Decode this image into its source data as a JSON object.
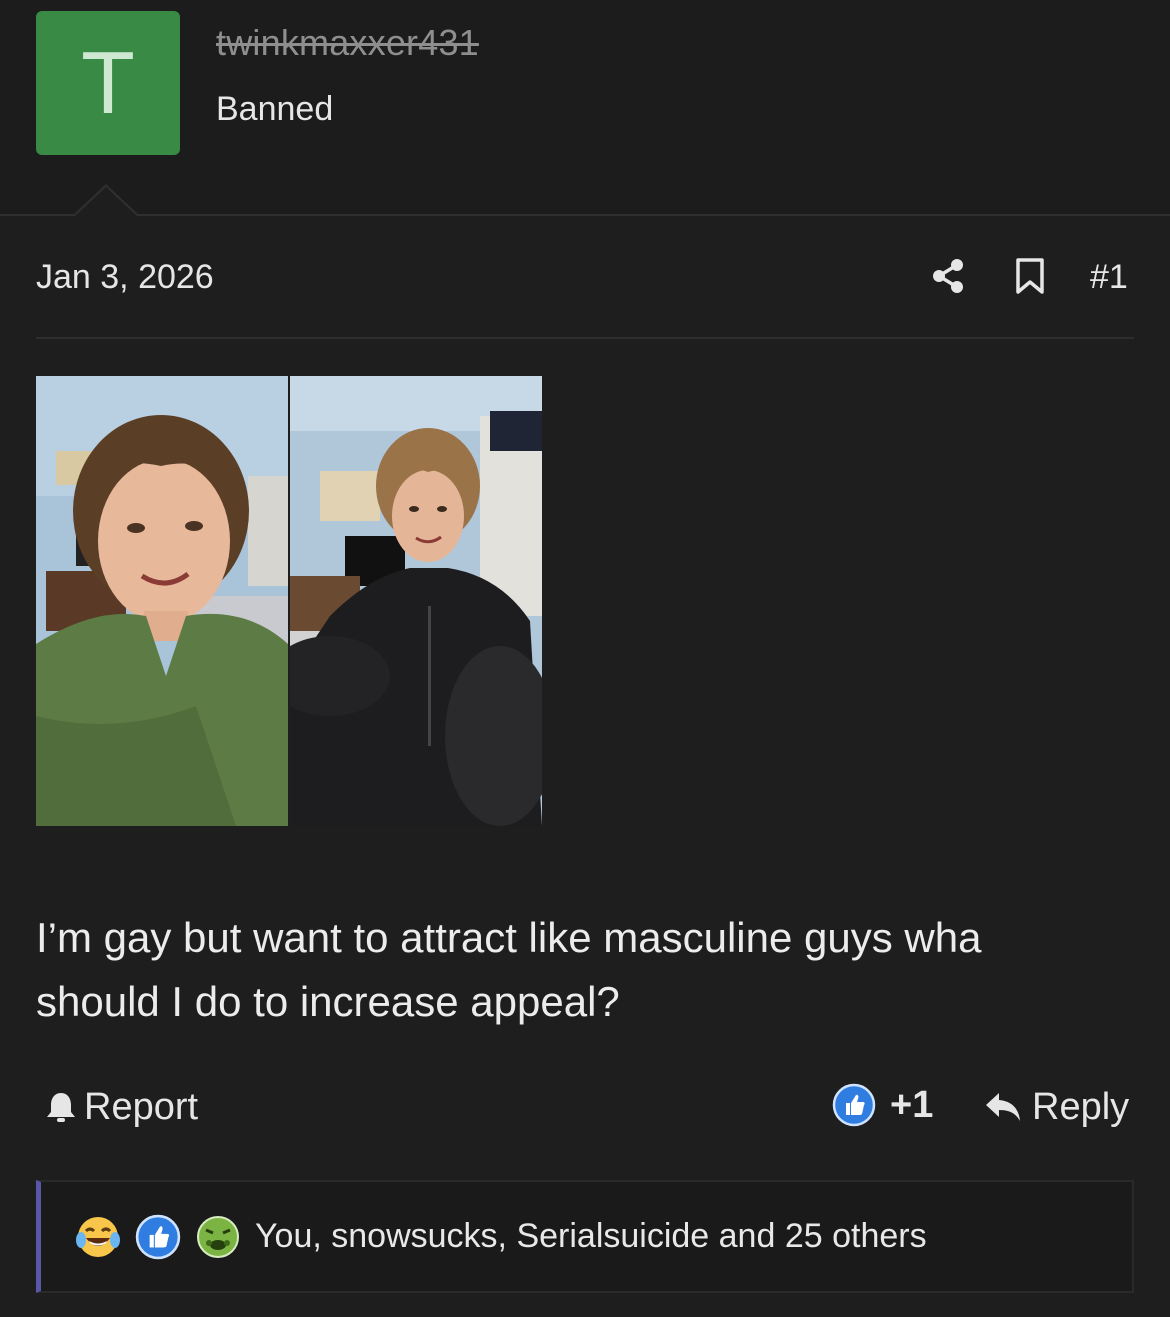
{
  "author": {
    "avatar_letter": "T",
    "username": "twinkmaxxer431",
    "title": "Banned"
  },
  "post": {
    "date": "Jan 3, 2026",
    "number": "#1",
    "body_line1": "I’m gay but want to attract like masculine guys wha",
    "body_line2": "should I do to increase appeal?",
    "actions": {
      "report_label": "Report",
      "like_count": "+1",
      "reply_label": "Reply"
    },
    "reactions": {
      "icons": [
        "laughing-crying-icon",
        "thumbs-up-icon",
        "nauseated-face-icon"
      ],
      "summary": "You, snowsucks, Serialsuicide and 25 others"
    }
  },
  "colors": {
    "background": "#1e1e1e",
    "avatar_bg": "#388a45",
    "like_blue": "#2f7de1",
    "reaction_border": "#5a56a8"
  }
}
